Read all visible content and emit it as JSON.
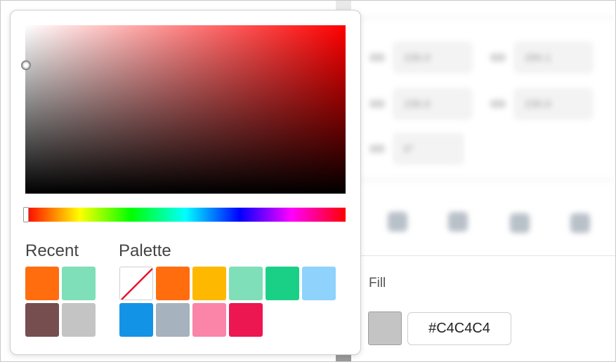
{
  "picker": {
    "selected_hue": "#ff0000",
    "recent_title": "Recent",
    "palette_title": "Palette",
    "recent": [
      "#ff6d0f",
      "#7edfb8",
      "#764e4f",
      "#c4c4c4"
    ],
    "palette": [
      "none",
      "#ff6d0f",
      "#ffb800",
      "#7edfb8",
      "#1ad086",
      "#8fd2fc",
      "#1393e6",
      "#a6b2be",
      "#fa85a8",
      "#ec1650"
    ]
  },
  "inspector": {
    "fill_label": "Fill",
    "fill_hex": "#C4C4C4",
    "fill_color": "#c4c4c4",
    "blurred_values": [
      "230.0",
      "284.1",
      "230.0",
      "230.0",
      "0°"
    ]
  }
}
